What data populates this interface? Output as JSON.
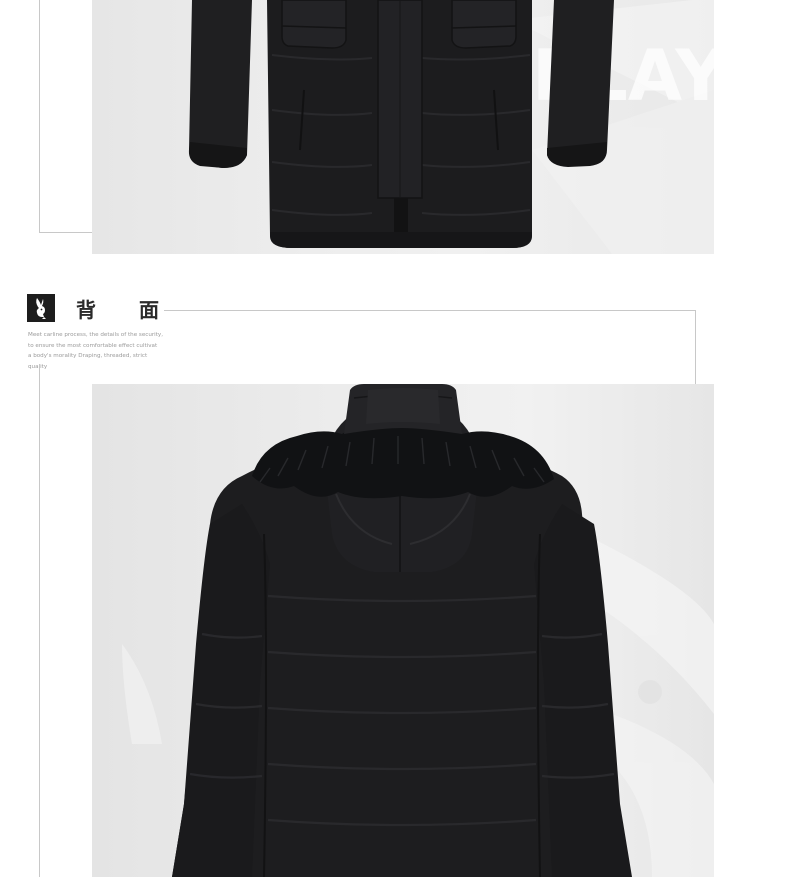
{
  "page": {
    "background": "#ffffff",
    "line_color": "#c8c8c8"
  },
  "top_photo": {
    "subject": "front-view of black hooded down jacket",
    "watermark_text": "PLAY",
    "background": "#ebebeb",
    "garment_color": "#1c1c1e"
  },
  "section": {
    "logo_icon": "bunny-logo-icon",
    "logo_background": "#1d1d1d",
    "title": "背 面",
    "subtitle_lines": [
      "Meet carline process, the details of the security,",
      "to ensure the most comfortable effect cultivat",
      "a body's morality Draping, threaded, strict quality"
    ]
  },
  "bottom_photo": {
    "subject": "back-view of black hooded down jacket with fur-trimmed hood",
    "background": "#ececec",
    "garment_color": "#1c1c1e",
    "fur_color": "#111214"
  }
}
